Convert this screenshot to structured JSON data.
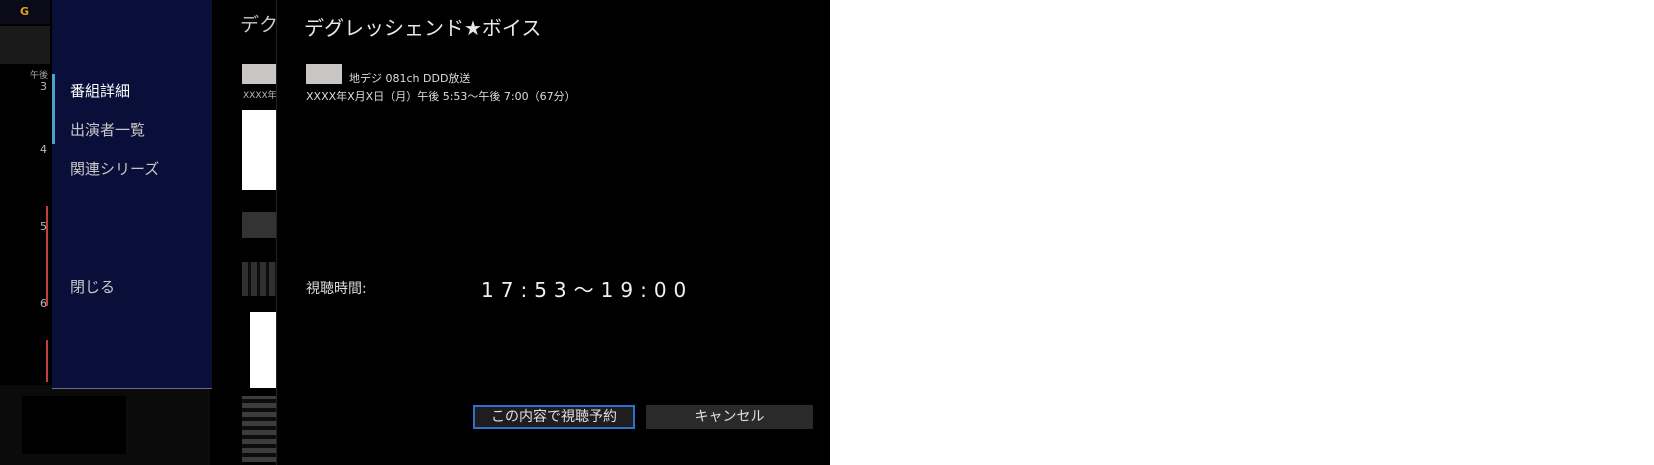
{
  "epg": {
    "logo_text": "G",
    "period": "午後",
    "hours": [
      "3",
      "4",
      "5",
      "6"
    ]
  },
  "menu": {
    "items": [
      {
        "label": "番組詳細"
      },
      {
        "label": "出演者一覧"
      },
      {
        "label": "関連シリーズ"
      },
      {
        "label": "閉じる"
      }
    ]
  },
  "background": {
    "title_fragment": "デク",
    "date_fragment": "XXXX年"
  },
  "dialog": {
    "title": "デグレッシェンド★ボイス",
    "channel": "地デジ 081ch DDD放送",
    "datetime": "XXXX年X月X日（月）午後 5:53〜午後 7:00（67分）",
    "watch_label": "視聴時間:",
    "watch_time": "17:53〜19:00",
    "confirm_button": "この内容で視聴予約",
    "cancel_button": "キャンセル"
  },
  "colors": {
    "menu_bg": "#0a0f3a",
    "focus_border": "#2f6fd0",
    "accent": "#4aa0d0"
  }
}
